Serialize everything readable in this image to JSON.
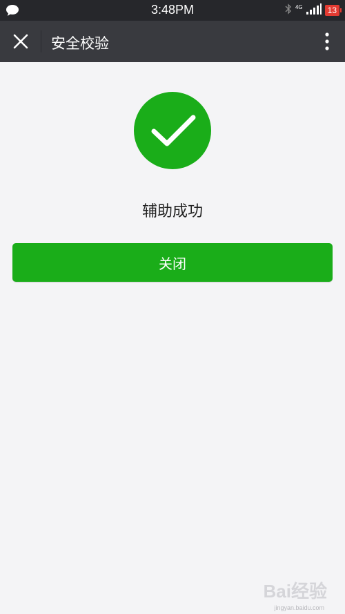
{
  "status_bar": {
    "time": "3:48PM",
    "network": "4G",
    "battery": "13"
  },
  "nav": {
    "title": "安全校验"
  },
  "result": {
    "message": "辅助成功"
  },
  "actions": {
    "close_label": "关闭"
  },
  "watermark": {
    "brand": "Bai经验",
    "url": "jingyan.baidu.com"
  },
  "colors": {
    "accent_green": "#1aad19",
    "nav_bg": "#393a3f",
    "status_bg": "#26272b",
    "page_bg": "#f4f4f6",
    "battery_red": "#e33b32"
  },
  "icons": [
    "message-icon",
    "bluetooth-icon",
    "signal-icon",
    "close-icon",
    "more-icon",
    "checkmark-icon"
  ]
}
